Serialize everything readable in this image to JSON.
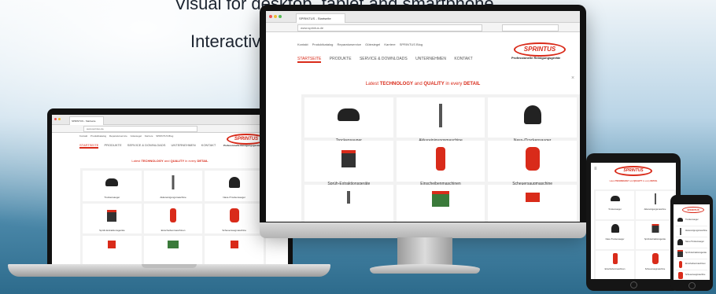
{
  "hero": {
    "line1": "Visual for desktop, tablet and smartphone.",
    "line2": "Interactive with hotspots."
  },
  "browser": {
    "tab_label": "SPRINTUS - Startseite",
    "url": "www.sprintus.de"
  },
  "site": {
    "logo": "SPRINTUS",
    "tagline": "Professionelle Reinigungsgeräte",
    "top_nav": [
      "Kontakt",
      "Produktkatalog",
      "Reparaturservice",
      "Gütesiegel",
      "Karriere",
      "SPRINTUS Blog"
    ],
    "main_nav": [
      "STARTSEITE",
      "PRODUKTE",
      "SERVICE & DOWNLOADS",
      "UNTERNEHMEN",
      "KONTAKT"
    ],
    "active_nav": "STARTSEITE",
    "banner_pre": "Latest",
    "banner_b1": "TECHNOLOGY",
    "banner_mid": "and",
    "banner_b2": "QUALITY",
    "banner_post": "in every",
    "banner_b3": "DETAIL",
    "products": [
      "Trockensauger",
      "Akkureinigungsmaschine",
      "Nass-/Trockensauger",
      "Sprüh-Extraktionsgeräte",
      "Einscheibenmaschinen",
      "Scheuersaugmaschine"
    ]
  },
  "colors": {
    "accent": "#d92b1a",
    "frame": "#111111",
    "background_top": "#eef4f8",
    "background_bottom": "#2d6b8c"
  }
}
